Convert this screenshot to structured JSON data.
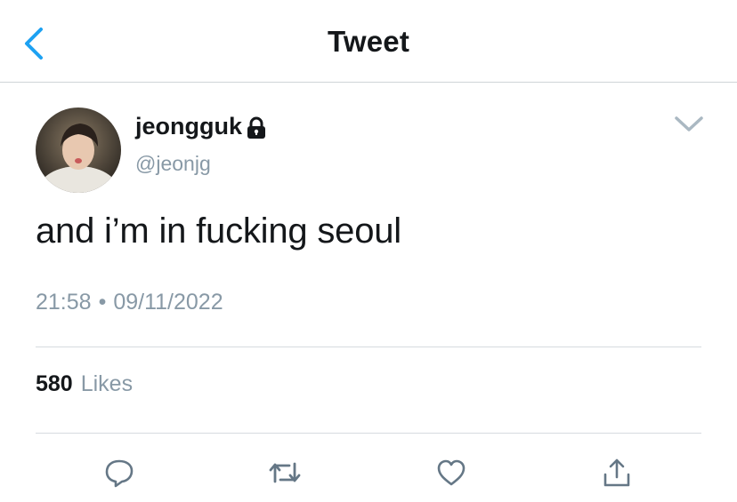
{
  "header": {
    "title": "Tweet",
    "back_icon": "chevron-left-icon"
  },
  "tweet": {
    "display_name": "jeongguk",
    "handle": "@jeonjg",
    "protected_icon": "lock-icon",
    "text": "and i’m in fucking seoul",
    "time": "21:58",
    "separator": "•",
    "date": "09/11/2022",
    "likes_count": "580",
    "likes_label": "Likes"
  },
  "actions": {
    "reply_icon": "reply-icon",
    "retweet_icon": "retweet-icon",
    "like_icon": "heart-icon",
    "share_icon": "share-icon"
  },
  "colors": {
    "accent": "#1da1f2",
    "text_primary": "#14171a",
    "text_secondary": "#8899a6",
    "divider": "#d6dbdf"
  }
}
